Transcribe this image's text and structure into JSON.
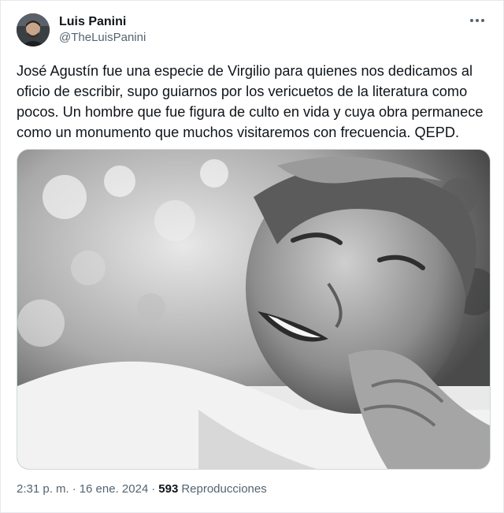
{
  "author": {
    "display_name": "Luis Panini",
    "handle": "@TheLuisPanini",
    "avatar_icon": "user-avatar-photo"
  },
  "more_icon": "more-horizontal-icon",
  "tweet": {
    "text": "José Agustín fue una especie de Virgilio para quienes nos dedicamos al\noficio de escribir, supo guiarnos por los vericuetos de la literatura como\npocos. Un hombre que fue figura de culto en vida y cuya obra permanece\ncomo un monumento que muchos visitaremos con frecuencia. QEPD.",
    "media_description_icon": "black-and-white-portrait-photo"
  },
  "meta": {
    "time": "2:31 p. m.",
    "separator": "·",
    "date": "16 ene. 2024",
    "views_count": "593",
    "views_label": "Reproducciones"
  },
  "colors": {
    "text_primary": "#0f1419",
    "text_secondary": "#536471",
    "border": "#cfd9de"
  }
}
